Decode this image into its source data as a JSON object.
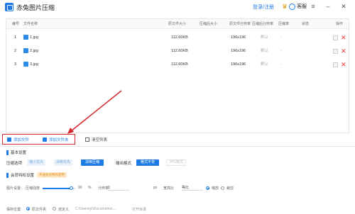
{
  "app": {
    "title": "赤兔图片压缩",
    "login": "登录/注册",
    "service": "客服"
  },
  "table": {
    "headers": [
      "编号",
      "文件名称",
      "原文件大小",
      "压缩后大小",
      "原文件分辨率",
      "压缩后分辨率",
      "压缩率",
      "状态",
      "操作"
    ],
    "rows": [
      {
        "id": "1",
        "name": "1.jpg",
        "size": "112.60KB",
        "res": "196x196",
        "new_res": "默认",
        "rate": "-"
      },
      {
        "id": "2",
        "name": "2.jpg",
        "size": "112.60KB",
        "res": "196x196",
        "new_res": "默认",
        "rate": "-"
      },
      {
        "id": "3",
        "name": "3.jpg",
        "size": "112.60KB",
        "res": "196x196",
        "new_res": "默认",
        "rate": "-"
      }
    ]
  },
  "toolbar": {
    "add_file": "添加文件",
    "add_folder": "添加文件夹",
    "clear": "清空列表"
  },
  "basic": {
    "title": "基本设置",
    "compress_label": "压缩选项",
    "options": [
      "缩小优先",
      "清晰优先",
      "清晰压缩"
    ],
    "format_label": "输出格式",
    "format_options": [
      "格式不变",
      "JPG格式"
    ]
  },
  "vip": {
    "title": "会员特权设置",
    "badge": "开通会员特权使用",
    "size_label": "图片设置:",
    "quality_label": "压缩强度",
    "quality_value": "90",
    "quality_suffix": "%",
    "res_label": "分辨率",
    "res_value": "0",
    "multiply": "px",
    "aspect_label": "宽高比",
    "aspect_value": "等比",
    "scale_on": "缩放",
    "scale_off": "裁剪"
  },
  "output": {
    "label": "保存位置:",
    "option1": "原文件夹",
    "option2": "自定义",
    "path": "C:\\Users\\yl\\Documents\\...",
    "open": "打开目录"
  },
  "colors": {
    "accent": "#1e7be6",
    "danger": "#e23434",
    "annotation": "#d6262b"
  }
}
